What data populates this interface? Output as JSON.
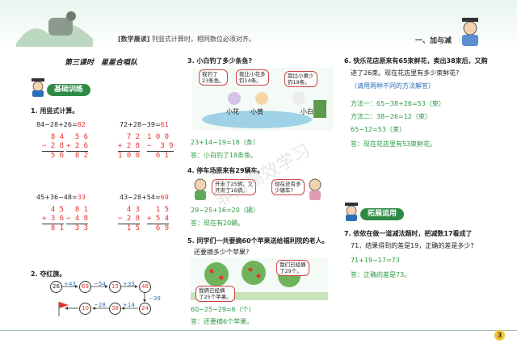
{
  "header": {
    "tag": "[数学晨读]",
    "hint": "列竖式计算时，相同数位必须对齐。",
    "unit": "一、加与减"
  },
  "lesson": {
    "title": "第三课时　星星合唱队"
  },
  "sections": {
    "basic": "基础训练",
    "extend": "拓展运用"
  },
  "q1": {
    "title": "1. 用竖式计算。",
    "items": [
      {
        "expr": "84−28+26=",
        "ans": "82"
      },
      {
        "expr": "72+28−39=",
        "ans": "61"
      },
      {
        "expr": "45+36−48=",
        "ans": "33"
      },
      {
        "expr": "43−28+54=",
        "ans": "69"
      }
    ],
    "work": [
      {
        "l1": "  8 4",
        "l2": "− 2 8",
        "l3": "  5 6"
      },
      {
        "l1": "  5 6",
        "l2": "+ 2 6",
        "l3": "  8 2"
      },
      {
        "l1": "  7 2",
        "l2": "+ 2 8",
        "l3": "1 0 0"
      },
      {
        "l1": "1 0 0",
        "l2": "−  3 9",
        "l3": "  6 1"
      },
      {
        "l1": "  4 5",
        "l2": "+ 3 6",
        "l3": "  8 1"
      },
      {
        "l1": "  8 1",
        "l2": "− 4 8",
        "l3": "  3 3"
      },
      {
        "l1": "  4 3",
        "l2": "− 2 8",
        "l3": "  1 5"
      },
      {
        "l1": "  1 5",
        "l2": "+ 5 4",
        "l3": "  6 9"
      }
    ]
  },
  "q2": {
    "title": "2. 夺红旗。",
    "top": [
      "26",
      "69",
      "15",
      "48"
    ],
    "top_ops": [
      "+43",
      "−54",
      "+33"
    ],
    "bottom": [
      "10",
      "38",
      "24"
    ],
    "bottom_ops": [
      "−28",
      "+14"
    ],
    "side_op": "−39"
  },
  "q3": {
    "title": "3. 小白钓了多少条鱼?",
    "bubbles": [
      "我钓了\n23条鱼。",
      "我比小花多\n钓14条。",
      "我比小黄少\n钓19条。"
    ],
    "names": [
      "小花",
      "小黄",
      "小白"
    ],
    "eq": "23+14−19=18（条）",
    "ans": "答：小白钓了18条鱼。"
  },
  "q4": {
    "title": "4. 停车场原来有29辆车。",
    "bubbles": [
      "开走了25辆，又\n开来了16辆。",
      "现在还有多\n少辆车?"
    ],
    "eq": "29−25+16=20（辆）",
    "ans": "答：现在有20辆。"
  },
  "q5": {
    "line1": "5. 同学们一共要摘60个苹果送给福利院的老人。",
    "line2": "还要摘多少个苹果?",
    "bubbles": [
      "我们已经摘\n了29个。",
      "我俩已经摘\n了25个苹果。"
    ],
    "eq": "60−25−29=6（个）",
    "ans": "答：还要摘6个苹果。"
  },
  "q6": {
    "line1": "6. 快乐花店原来有65束鲜花，卖出38束后，又购",
    "line2": "进了26束。现在花店里有多少束鲜花?",
    "hint": "（请用两种不同的方法解答）",
    "m1": "方法一：65−38+26=53（束）",
    "m2": "方法二：38−26=12（束）",
    "m2b": "65−12=53（束）",
    "ans": "答：现在花店里有53束鲜花。"
  },
  "q7": {
    "line1": "7. 依依在做一道减法题时，把减数17看成了",
    "line2": "71，结果得到的差是19，正确的差是多少?",
    "eq": "71+19−17=73",
    "ans": "答：正确的差是73。"
  },
  "watermark": "非常高效学习",
  "page_number": "3",
  "colors": {
    "red": "#e8322d",
    "green": "#2e8b46",
    "blue": "#2d6fb4"
  }
}
